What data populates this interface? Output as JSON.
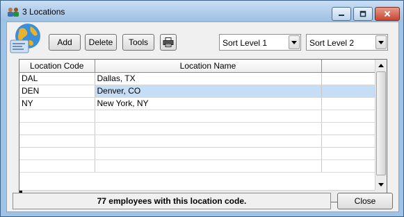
{
  "window": {
    "title": "3 Locations",
    "minimize_icon": "minimize-icon",
    "maximize_icon": "maximize-icon",
    "close_icon": "close-x-icon"
  },
  "toolbar": {
    "add_label": "Add",
    "delete_label": "Delete",
    "tools_label": "Tools",
    "print_icon": "printer-icon",
    "sort1": {
      "value": "Sort Level 1"
    },
    "sort2": {
      "value": "Sort Level 2"
    }
  },
  "grid": {
    "columns": [
      "Location Code",
      "Location Name",
      ""
    ],
    "rows": [
      {
        "code": "DAL",
        "name": "Dallas, TX",
        "extra": "",
        "selected": false
      },
      {
        "code": "DEN",
        "name": "Denver, CO",
        "extra": "",
        "selected": true
      },
      {
        "code": "NY",
        "name": "New York, NY",
        "extra": "",
        "selected": false
      }
    ],
    "empty_rows": 5
  },
  "footer": {
    "status_text": "77 employees with this location code.",
    "close_label": "Close"
  },
  "colors": {
    "frame": "#9fc3e6",
    "selection": "#c5def6"
  }
}
